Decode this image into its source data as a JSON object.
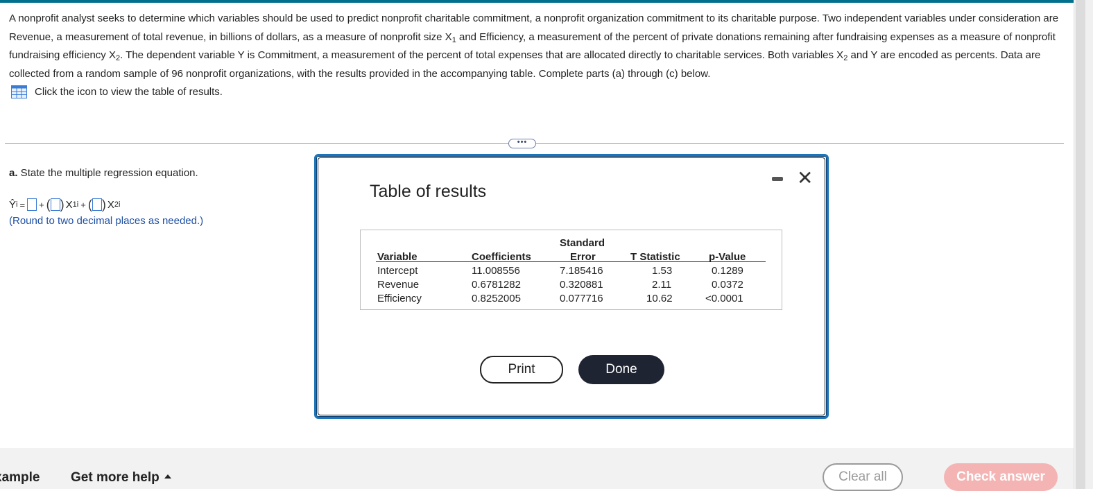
{
  "problem": {
    "s1": "A nonprofit analyst seeks to determine which variables should be used to predict nonprofit charitable commitment, a nonprofit organization commitment to its charitable purpose. Two independent variables under consideration are Revenue, a measurement of total revenue, in billions of dollars, as a measure of nonprofit size X",
    "sub1": "1",
    "s2": " and Efficiency, a measurement of the percent of private donations remaining after fundraising expenses as a measure of nonprofit fundraising efficiency X",
    "sub2": "2",
    "s3": ". The dependent variable Y is Commitment, a measurement of the percent of total expenses that are allocated directly to charitable services. Both variables X",
    "sub3": "2",
    "s4": " and Y are encoded as percents. Data are collected from a random sample of 96 nonprofit organizations, with the results provided in the accompanying table. Complete parts (a) through (c) below."
  },
  "table_link": {
    "text": "Click the icon to view the table of results.",
    "icon": "table-grid-icon"
  },
  "more_button": {
    "label": "•••"
  },
  "part_a": {
    "letter": "a.",
    "prompt": " State the multiple regression equation.",
    "lhs": "Ŷ",
    "lhs_sub": "i",
    "eq": "=",
    "plus1": "+",
    "x1": "X",
    "x1_sub": "1i",
    "plus2": "+",
    "x2": "X",
    "x2_sub": "2i",
    "hint": "(Round to two decimal places as needed.)"
  },
  "modal": {
    "title": "Table of results",
    "minimize_icon": "minimize-icon",
    "close_icon": "close-icon",
    "close_glyph": "✕",
    "headers": {
      "variable": "Variable",
      "coefficients": "Coefficients",
      "std_error_1": "Standard",
      "std_error_2": "Error",
      "t_stat": "T Statistic",
      "p_value": "p-Value"
    },
    "rows": [
      {
        "variable": "Intercept",
        "coefficient": "11.008556",
        "std_error": "7.185416",
        "t_stat": "1.53",
        "p_value": "0.1289"
      },
      {
        "variable": "Revenue",
        "coefficient": "0.6781282",
        "std_error": "0.320881",
        "t_stat": "2.11",
        "p_value": "0.0372"
      },
      {
        "variable": "Efficiency",
        "coefficient": "0.8252005",
        "std_error": "0.077716",
        "t_stat": "10.62",
        "p_value": "<0.0001"
      }
    ],
    "print_label": "Print",
    "done_label": "Done"
  },
  "footer": {
    "example_label": "xample",
    "help_label": "Get more help",
    "clear_label": "Clear all",
    "check_label": "Check answer"
  },
  "colors": {
    "accent": "#1b75bb",
    "top_bar": "#00708d",
    "hint_text": "#1d4fa3",
    "done_bg": "#1f2433",
    "check_bg": "#f4b4b4"
  }
}
